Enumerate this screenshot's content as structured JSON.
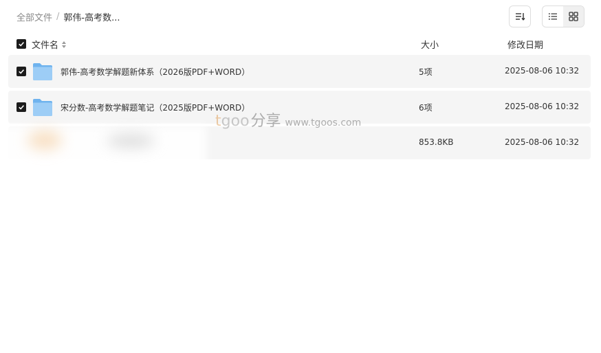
{
  "breadcrumb": {
    "root": "全部文件",
    "separator": "/",
    "current": "郭伟-高考数..."
  },
  "toolbar": {
    "sort_icon": "sort-icon",
    "list_view_icon": "list-view-icon",
    "grid_view_icon": "grid-view-icon",
    "active_view": "grid"
  },
  "table": {
    "headers": {
      "name": "文件名",
      "size": "大小",
      "modified": "修改日期"
    },
    "rows": [
      {
        "name": "郭伟-高考数学解题新体系（2026版PDF+WORD）",
        "size": "5项",
        "modified": "2025-08-06 10:32",
        "type": "folder",
        "checked": true
      },
      {
        "name": "宋分数-高考数学解题笔记（2025版PDF+WORD）",
        "size": "6项",
        "modified": "2025-08-06 10:32",
        "type": "folder",
        "checked": true
      },
      {
        "name": "",
        "size": "853.8KB",
        "modified": "2025-08-06 10:32",
        "type": "file",
        "checked": false
      }
    ]
  },
  "watermark": {
    "brand_t": "t",
    "brand_goo": "goo",
    "brand_cn": "分享",
    "url": "www.tgoos.com"
  },
  "colors": {
    "row_bg": "#f5f5f5",
    "checkbox": "#1c1c1c",
    "folder": "#7cbcf2",
    "watermark_accent": "#e2a96a"
  }
}
